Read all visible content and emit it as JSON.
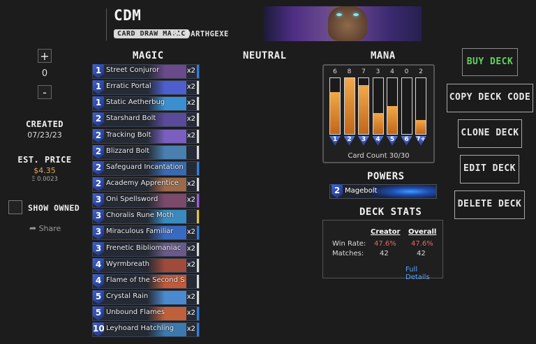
{
  "deck": {
    "title": "CDM",
    "tag": "CARD DRAW MAGIC",
    "byline": "BY DARTHGEXE"
  },
  "left": {
    "plus": "+",
    "minus": "-",
    "quantity": "0",
    "created_label": "CREATED",
    "created_value": "07/23/23",
    "price_label": "EST. PRICE",
    "price_value": "$4.35",
    "price_eth": "Ξ 0.0023",
    "show_owned": "SHOW OWNED",
    "share": "Share"
  },
  "columns": {
    "magic": "MAGIC",
    "neutral": "NEUTRAL",
    "mana": "MANA",
    "powers": "POWERS",
    "deck_stats": "DECK STATS"
  },
  "cards": [
    {
      "cost": "1",
      "name": "Street Conjuror",
      "count": "x2",
      "rarity": "#2f7fe0",
      "art": "#6a4a8a"
    },
    {
      "cost": "1",
      "name": "Erratic Portal",
      "count": "x2",
      "rarity": "#d9d9d9",
      "art": "#4d5fcf"
    },
    {
      "cost": "1",
      "name": "Static Aetherbug",
      "count": "x2",
      "rarity": "#d9d9d9",
      "art": "#3a8fd0"
    },
    {
      "cost": "2",
      "name": "Starshard Bolt",
      "count": "x2",
      "rarity": "#d9d9d9",
      "art": "#5a4a9a"
    },
    {
      "cost": "2",
      "name": "Tracking Bolt",
      "count": "x2",
      "rarity": "#d9d9d9",
      "art": "#7a5fbf"
    },
    {
      "cost": "2",
      "name": "Blizzard Bolt",
      "count": "",
      "rarity": "#d9d9d9",
      "art": "#4a7fb0"
    },
    {
      "cost": "2",
      "name": "Safeguard Incantation",
      "count": "",
      "rarity": "#2f7fe0",
      "art": "#3a6ab0"
    },
    {
      "cost": "2",
      "name": "Academy Apprentice",
      "count": "x2",
      "rarity": "#d9d9d9",
      "art": "#9a6a4a"
    },
    {
      "cost": "3",
      "name": "Oni Spellsword",
      "count": "x2",
      "rarity": "#a55ad6",
      "art": "#7a4a6a"
    },
    {
      "cost": "3",
      "name": "Choralis Rune Moth",
      "count": "",
      "rarity": "#e6c23a",
      "art": "#3a8ac0"
    },
    {
      "cost": "3",
      "name": "Miraculous Familiar",
      "count": "x2",
      "rarity": "#2f7fe0",
      "art": "#3a6ac0"
    },
    {
      "cost": "3",
      "name": "Frenetic Bibliomaniac",
      "count": "x2",
      "rarity": "#d9d9d9",
      "art": "#6a5a8a"
    },
    {
      "cost": "4",
      "name": "Wyrmbreath",
      "count": "x2",
      "rarity": "#d9d9d9",
      "art": "#a04a3a"
    },
    {
      "cost": "4",
      "name": "Flame of the Second Shatte...",
      "count": "",
      "rarity": "#d9d9d9",
      "art": "#c05a3a"
    },
    {
      "cost": "5",
      "name": "Crystal Rain",
      "count": "x2",
      "rarity": "#d9d9d9",
      "art": "#4a8ad0"
    },
    {
      "cost": "5",
      "name": "Unbound Flames",
      "count": "x2",
      "rarity": "#2f7fe0",
      "art": "#c0603a"
    },
    {
      "cost": "10",
      "name": "Leyhoard Hatchling",
      "count": "x2",
      "rarity": "#2f7fe0",
      "art": "#3a7ab0"
    }
  ],
  "mana": {
    "counts": [
      "6",
      "8",
      "7",
      "3",
      "4",
      "0",
      "2"
    ],
    "fill_fraction": [
      0.75,
      1.0,
      0.875,
      0.375,
      0.5,
      0.0,
      0.25
    ],
    "labels": [
      "1",
      "2",
      "3",
      "4",
      "5",
      "6",
      "7+"
    ],
    "card_count": "Card Count 30/30"
  },
  "power": {
    "cost": "2",
    "name": "Magebolt"
  },
  "stats": {
    "creator_header": "Creator",
    "overall_header": "Overall",
    "win_rate_label": "Win Rate:",
    "creator_win_rate": "47.6%",
    "overall_win_rate": "47.6%",
    "matches_label": "Matches:",
    "creator_matches": "42",
    "overall_matches": "42",
    "full_details": "Full Details"
  },
  "buttons": {
    "buy": "BUY DECK",
    "copy": "COPY DECK CODE",
    "clone": "CLONE DECK",
    "edit": "EDIT DECK",
    "delete": "DELETE DECK"
  },
  "colors": {
    "buy_accent": "#5fd45f",
    "win_rate": "#e26a6a",
    "link": "#5aa4ff",
    "mana_fill": "#e8912e"
  }
}
